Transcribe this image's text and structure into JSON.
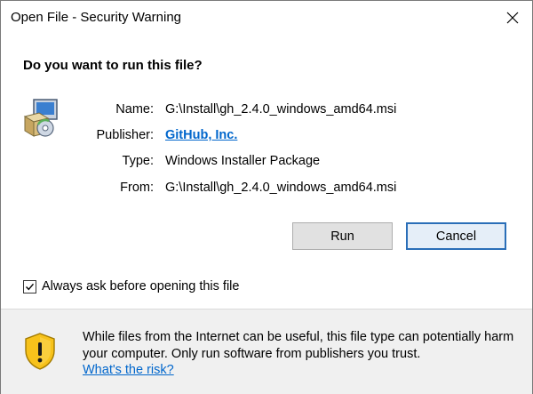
{
  "window": {
    "title": "Open File - Security Warning"
  },
  "dialog": {
    "question": "Do you want to run this file?",
    "fields": {
      "name_label": "Name:",
      "name_value": "G:\\Install\\gh_2.4.0_windows_amd64.msi",
      "publisher_label": "Publisher:",
      "publisher_value": "GitHub, Inc.",
      "type_label": "Type:",
      "type_value": "Windows Installer Package",
      "from_label": "From:",
      "from_value": "G:\\Install\\gh_2.4.0_windows_amd64.msi"
    },
    "buttons": {
      "run": "Run",
      "cancel": "Cancel"
    },
    "checkbox": {
      "label": "Always ask before opening this file",
      "checked": true
    }
  },
  "footer": {
    "warning": "While files from the Internet can be useful, this file type can potentially harm your computer. Only run software from publishers you trust.",
    "risk_link": "What's the risk?"
  },
  "colors": {
    "link": "#0066cc",
    "default_button_border": "#2a6eb8",
    "footer_bg": "#f0f0f0",
    "shield_yellow": "#f7c21b"
  }
}
